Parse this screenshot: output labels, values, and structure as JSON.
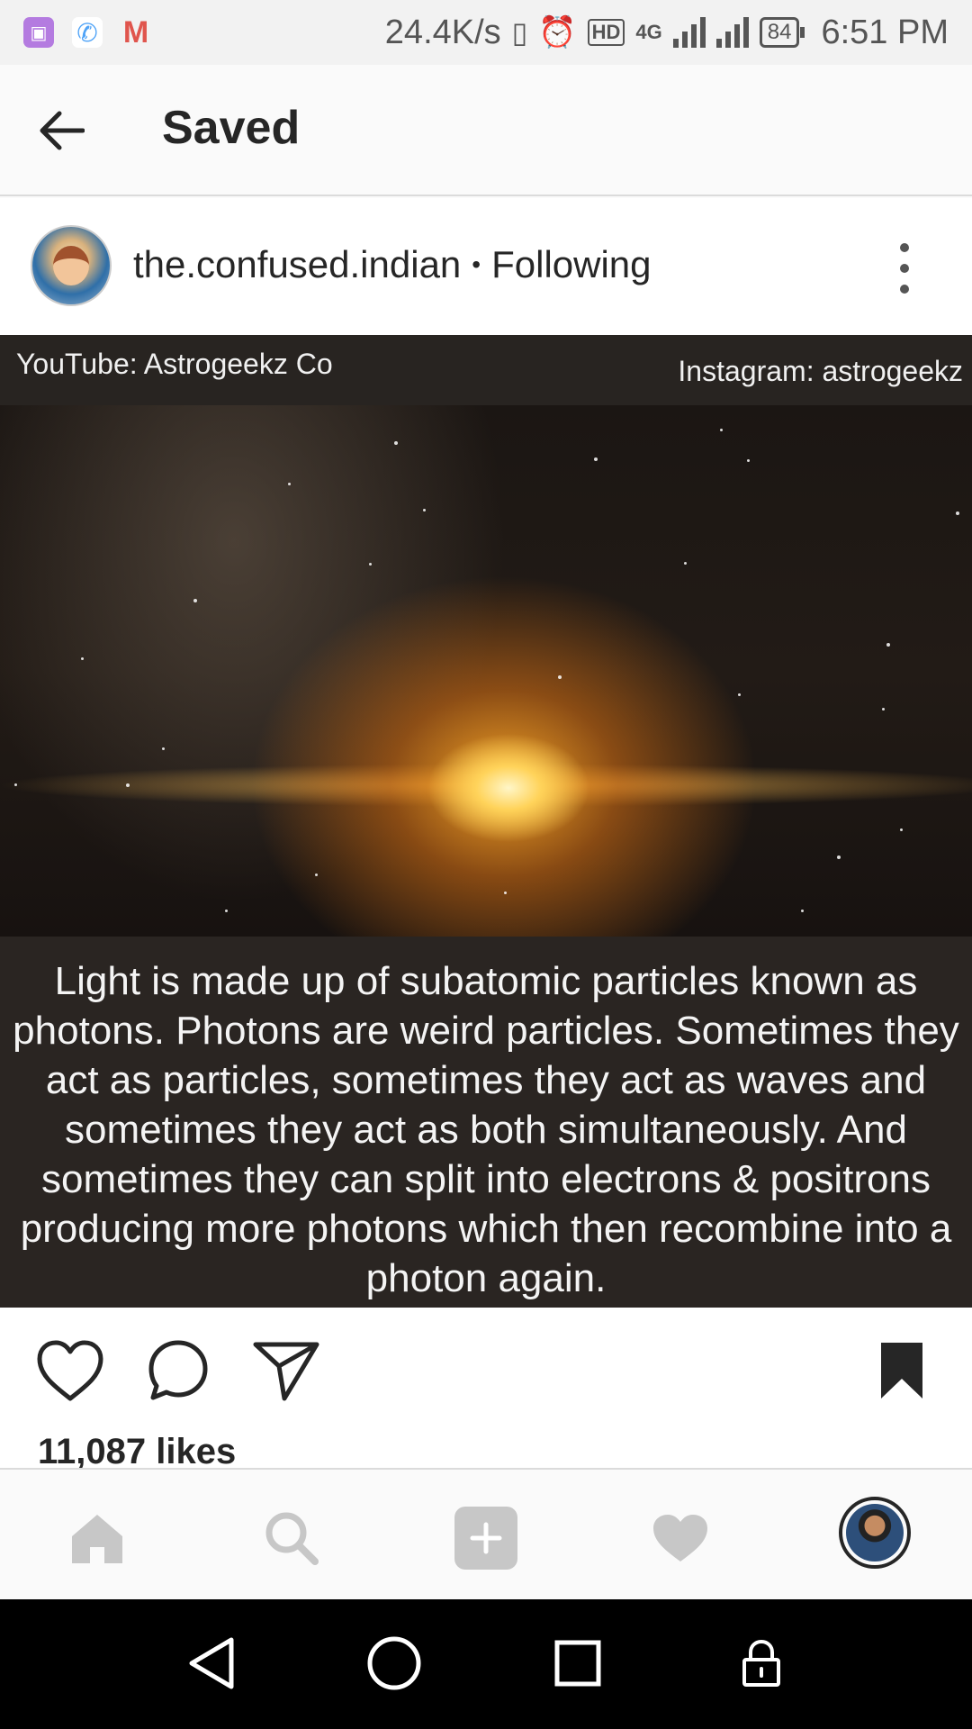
{
  "status_bar": {
    "speed": "24.4K/s",
    "hd": "HD",
    "network": "4G",
    "battery": "84",
    "time": "6:51 PM"
  },
  "header": {
    "title": "Saved"
  },
  "post": {
    "username": "the.confused.indian",
    "separator": "•",
    "follow_status": "Following",
    "image": {
      "top_left_label": "YouTube: Astrogeekz Co",
      "top_right_label": "Instagram: astrogeekz",
      "caption": "Light is made up of subatomic particles known as photons. Photons are weird particles. Sometimes they act as particles, sometimes they act as waves and sometimes they act as both simultaneously. And sometimes they can split into electrons & positrons producing more photons which then recombine into a photon again."
    },
    "likes": "11,087 likes"
  },
  "bottom_nav": {
    "items": [
      "home-icon",
      "search-icon",
      "add-icon",
      "activity-heart-icon",
      "profile-avatar"
    ]
  },
  "colors": {
    "text": "#262626",
    "nav_icon": "#c7c7c7",
    "divider": "#dbdbdb"
  }
}
